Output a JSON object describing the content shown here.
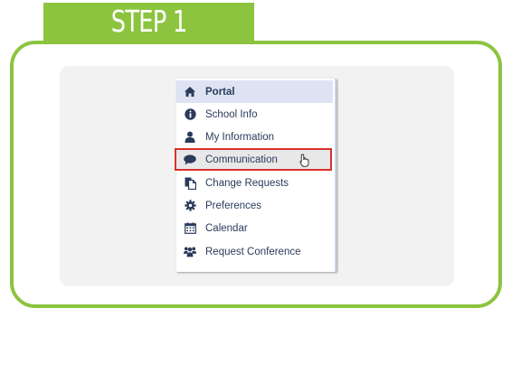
{
  "step": {
    "label": "STEP 1"
  },
  "menu": {
    "items": [
      {
        "label": "Portal",
        "icon": "home-icon",
        "active": true
      },
      {
        "label": "School Info",
        "icon": "info-icon"
      },
      {
        "label": "My Information",
        "icon": "user-icon"
      },
      {
        "label": "Communication",
        "icon": "chat-bubble-icon",
        "highlighted": true
      },
      {
        "label": "Change Requests",
        "icon": "documents-icon"
      },
      {
        "label": "Preferences",
        "icon": "gear-icon"
      },
      {
        "label": "Calendar",
        "icon": "calendar-icon"
      },
      {
        "label": "Request Conference",
        "icon": "group-icon"
      }
    ]
  },
  "colors": {
    "accent_green": "#8cc43f",
    "highlight_red": "#d9302b",
    "icon_navy": "#2a3b5c",
    "active_bg": "#dde3f3"
  }
}
